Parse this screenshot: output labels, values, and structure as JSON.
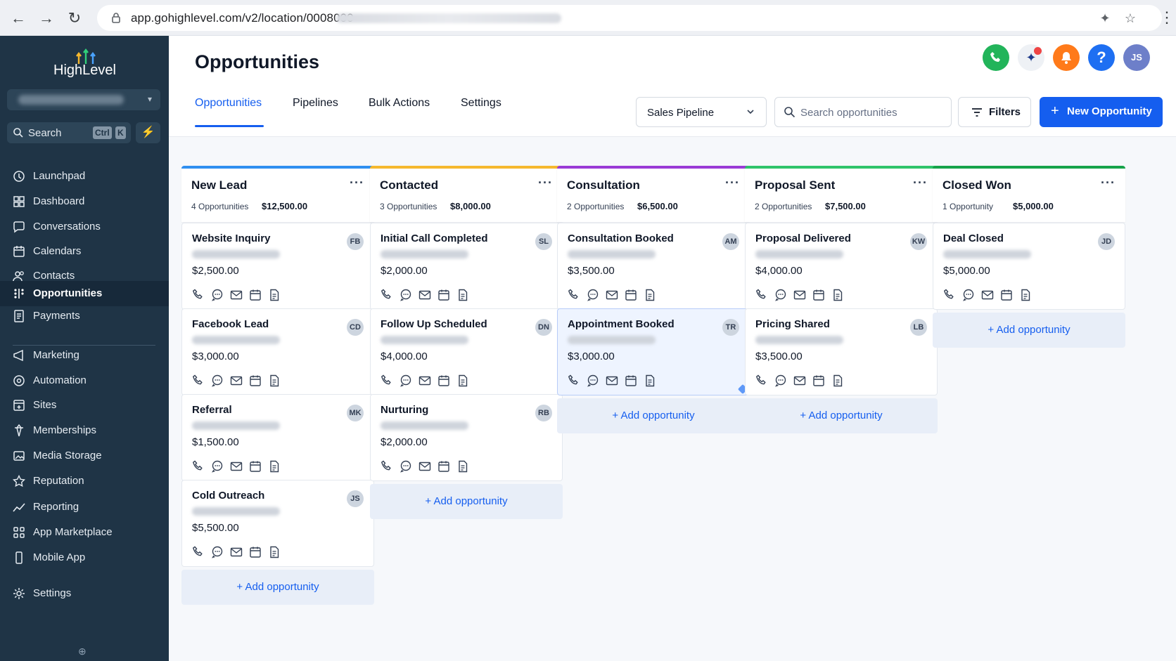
{
  "browser": {
    "url": "app.gohighlevel.com/v2/location/0008000"
  },
  "sidebar": {
    "logo_text": "HighLevel",
    "search_label": "Search",
    "search_kbd_1": "Ctrl",
    "search_kbd_2": "K",
    "items": [
      {
        "label": "Launchpad",
        "icon": "launchpad-icon"
      },
      {
        "label": "Dashboard",
        "icon": "dashboard-icon"
      },
      {
        "label": "Conversations",
        "icon": "chat-icon"
      },
      {
        "label": "Calendars",
        "icon": "calendar-icon"
      },
      {
        "label": "Contacts",
        "icon": "contacts-icon"
      },
      {
        "label": "Opportunities",
        "icon": "opportunities-icon",
        "active": true
      },
      {
        "label": "Payments",
        "icon": "payments-icon"
      },
      {
        "label": "Marketing",
        "icon": "marketing-icon"
      },
      {
        "label": "Automation",
        "icon": "automation-icon"
      },
      {
        "label": "Sites",
        "icon": "sites-icon"
      },
      {
        "label": "Memberships",
        "icon": "memberships-icon"
      },
      {
        "label": "Media Storage",
        "icon": "media-storage-icon"
      },
      {
        "label": "Reputation",
        "icon": "star-icon"
      },
      {
        "label": "Reporting",
        "icon": "reporting-icon"
      },
      {
        "label": "App Marketplace",
        "icon": "app-grid-icon"
      },
      {
        "label": "Mobile App",
        "icon": "mobile-icon"
      },
      {
        "label": "Settings",
        "icon": "gear-icon"
      }
    ]
  },
  "header": {
    "title": "Opportunities",
    "tabs": [
      "Opportunities",
      "Pipelines",
      "Bulk Actions",
      "Settings"
    ],
    "pipeline_select": "Sales Pipeline",
    "search_placeholder": "Search opportunities",
    "filters_label": "Filters",
    "new_button_label": "New Opportunity",
    "avatar_initials": "JS",
    "colors": {
      "phone": "#22b45a",
      "bell": "#ff7a1a",
      "help": "#1e6ff2",
      "primary": "#155eef"
    }
  },
  "board": {
    "add_label": "Add opportunity",
    "columns": [
      {
        "title": "New Lead",
        "count": "4 Opportunities",
        "total": "$12,500.00",
        "color": "#2f8ff0",
        "cards": [
          {
            "title": "Website Inquiry",
            "amount": "$2,500.00",
            "initials": "FB"
          },
          {
            "title": "Facebook Lead",
            "amount": "$3,000.00",
            "initials": "CD"
          },
          {
            "title": "Referral",
            "amount": "$1,500.00",
            "initials": "MK"
          },
          {
            "title": "Cold Outreach",
            "amount": "$5,500.00",
            "initials": "JS"
          }
        ]
      },
      {
        "title": "Contacted",
        "count": "3 Opportunities",
        "total": "$8,000.00",
        "color": "#f5b82e",
        "cards": [
          {
            "title": "Initial Call Completed",
            "amount": "$2,000.00",
            "initials": "SL"
          },
          {
            "title": "Follow Up Scheduled",
            "amount": "$4,000.00",
            "initials": "DN"
          },
          {
            "title": "Nurturing",
            "amount": "$2,000.00",
            "initials": "RB"
          }
        ]
      },
      {
        "title": "Consultation",
        "count": "2 Opportunities",
        "total": "$6,500.00",
        "color": "#9a3bd6",
        "cards": [
          {
            "title": "Consultation Booked",
            "amount": "$3,500.00",
            "initials": "AM"
          },
          {
            "title": "Appointment Booked",
            "amount": "$3,000.00",
            "initials": "TR",
            "highlight": true
          }
        ]
      },
      {
        "title": "Proposal Sent",
        "count": "2 Opportunities",
        "total": "$7,500.00",
        "color": "#2fc46a",
        "cards": [
          {
            "title": "Proposal Delivered",
            "amount": "$4,000.00",
            "initials": "KW"
          },
          {
            "title": "Pricing Shared",
            "amount": "$3,500.00",
            "initials": "LB"
          }
        ]
      },
      {
        "title": "Closed Won",
        "count": "1 Opportunity",
        "total": "$5,000.00",
        "color": "#16a34a",
        "cards": [
          {
            "title": "Deal Closed",
            "amount": "$5,000.00",
            "initials": "JD"
          }
        ]
      }
    ]
  }
}
